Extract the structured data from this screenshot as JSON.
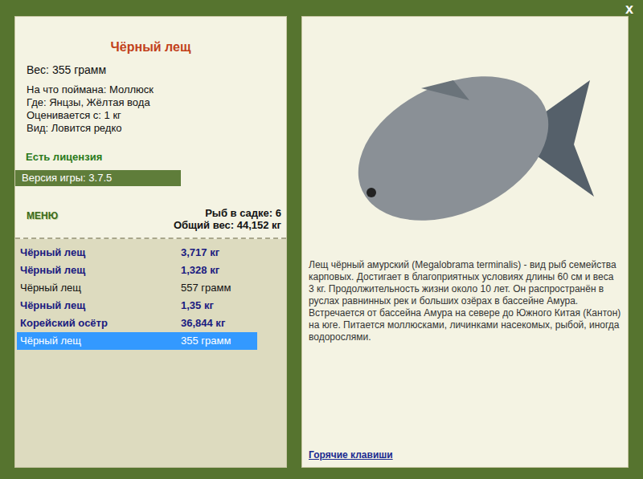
{
  "window": {
    "close": "x"
  },
  "fish": {
    "title": "Чёрный лещ",
    "weight": "Вес: 355 грамм",
    "details": [
      "На что поймана: Моллюск",
      "Где: Янцзы, Жёлтая вода",
      "Оценивается с: 1 кг",
      "Вид: Ловится редко"
    ]
  },
  "license": "Есть лицензия",
  "version": "Версия игры: 3.7.5",
  "menu_button": "МЕНЮ",
  "keepnet": {
    "count": "Рыб в садке: 6",
    "total": "Общий вес: 44,152 кг"
  },
  "catch_list": [
    {
      "name": "Чёрный лещ",
      "weight": "3,717 кг",
      "trophy": true,
      "selected": false
    },
    {
      "name": "Чёрный лещ",
      "weight": "1,328 кг",
      "trophy": true,
      "selected": false
    },
    {
      "name": "Чёрный лещ",
      "weight": "557 грамм",
      "trophy": false,
      "selected": false
    },
    {
      "name": "Чёрный лещ",
      "weight": "1,35 кг",
      "trophy": true,
      "selected": false
    },
    {
      "name": "Корейский осётр",
      "weight": "36,844 кг",
      "trophy": true,
      "selected": false
    },
    {
      "name": "Чёрный лещ",
      "weight": "355 грамм",
      "trophy": false,
      "selected": true
    }
  ],
  "description": "Лещ чёрный амурский (Megalobrama terminalis) - вид рыб семейства карповых. Достигает в благоприятных условиях длины 60 см и веса 3 кг. Продолжительность жизни около 10 лет. Он распространён в руслах равнинных рек и больших озёрах в бассейне Амура. Встречается от бассейна Амура на севере до Южного Китая (Кантон) на юге. Питается моллюсками, личинками насекомых, рыбой, иногда водорослями.",
  "hotkeys_link": "Горячие клавиши"
}
